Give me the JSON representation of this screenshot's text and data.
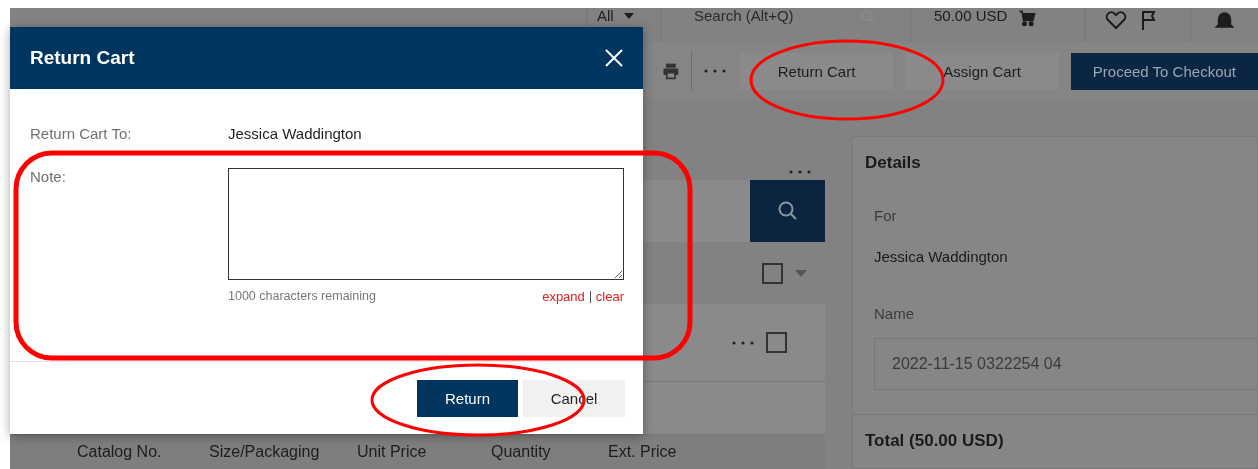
{
  "header": {
    "scope": "All",
    "search_placeholder": "Search (Alt+Q)",
    "cart_total": "50.00 USD"
  },
  "toolbar": {
    "buttons": [
      {
        "label": "Return Cart",
        "kind": "plain"
      },
      {
        "label": "Assign Cart",
        "kind": "plain"
      },
      {
        "label": "Proceed To Checkout",
        "kind": "primary"
      }
    ]
  },
  "list": {
    "select_all_checked": false,
    "item_checked": false
  },
  "table": {
    "columns": [
      "Catalog No.",
      "Size/Packaging",
      "Unit Price",
      "Quantity",
      "Ext. Price"
    ]
  },
  "details": {
    "title": "Details",
    "for_label": "For",
    "for_value": "Jessica Waddington",
    "name_label": "Name",
    "name_value": "2022-11-15 0322254 04",
    "total": "Total (50.00 USD)"
  },
  "dialog": {
    "title": "Return Cart",
    "return_to_label": "Return Cart To:",
    "return_to_value": "Jessica Waddington",
    "note_label": "Note:",
    "remaining": "1000 characters remaining",
    "links": [
      "expand",
      "clear"
    ],
    "buttons": [
      {
        "label": "Return",
        "kind": "primary"
      },
      {
        "label": "Cancel",
        "kind": "secondary"
      }
    ]
  }
}
